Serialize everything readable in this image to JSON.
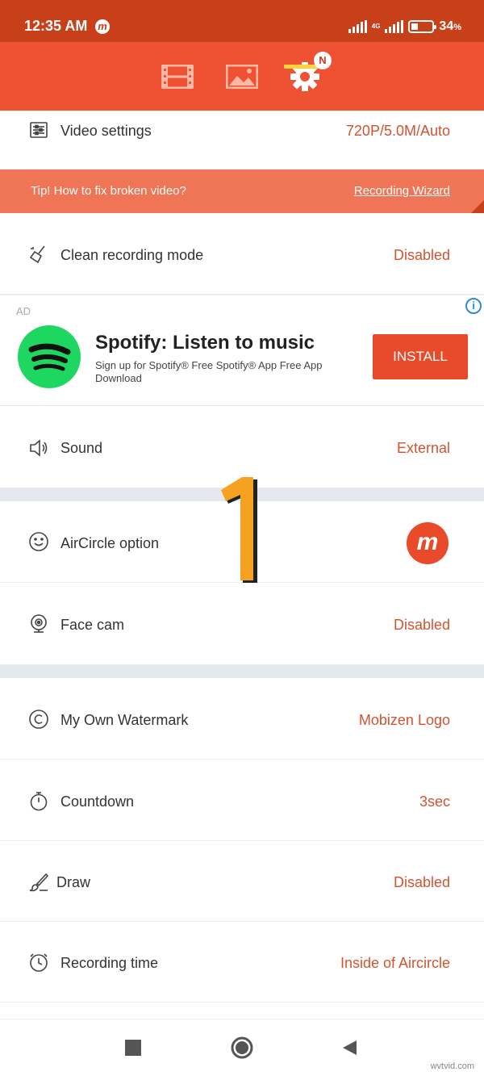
{
  "status_bar": {
    "time": "12:35 AM",
    "app_icon_letter": "m",
    "network_type": "4G",
    "battery_percent": "34",
    "battery_unit": "%",
    "battery_level": 0.34
  },
  "top_nav": {
    "tabs": [
      {
        "name": "video",
        "icon": "film-icon"
      },
      {
        "name": "image",
        "icon": "image-icon"
      },
      {
        "name": "settings",
        "icon": "gear-icon",
        "active": true
      }
    ],
    "badge": "N"
  },
  "settings": {
    "video_settings": {
      "label": "Video settings",
      "value": "720P/5.0M/Auto",
      "icon": "sliders-icon"
    },
    "tip": {
      "text": "Tip! How to fix broken video?",
      "link": "Recording Wizard"
    },
    "clean_recording": {
      "label": "Clean recording mode",
      "value": "Disabled",
      "icon": "broom-icon"
    },
    "sound": {
      "label": "Sound",
      "value": "External",
      "icon": "speaker-icon"
    },
    "aircircle": {
      "label": "AirCircle option",
      "icon": "smiley-icon",
      "logo_letter": "m"
    },
    "face_cam": {
      "label": "Face cam",
      "value": "Disabled",
      "icon": "webcam-icon"
    },
    "watermark": {
      "label": "My Own Watermark",
      "value": "Mobizen Logo",
      "icon": "copyright-icon"
    },
    "countdown": {
      "label": "Countdown",
      "value": "3sec",
      "icon": "stopwatch-icon"
    },
    "draw": {
      "label": "Draw",
      "value": "Disabled",
      "icon": "brush-icon"
    },
    "recording_time": {
      "label": "Recording time",
      "value": "Inside of Aircircle",
      "icon": "clock-icon"
    }
  },
  "ad": {
    "label": "AD",
    "info": "i",
    "title": "Spotify: Listen to music",
    "description": "Sign up for Spotify® Free Spotify® App Free App Download",
    "button": "INSTALL"
  },
  "annotation": {
    "number": "1"
  },
  "site_watermark": "wvtvid.com",
  "colors": {
    "status_bar": "#c8401a",
    "nav": "#ef5233",
    "accent": "#d35330",
    "tip": "#f07556",
    "underline": "#ffd23a",
    "spotify": "#1ed760"
  }
}
